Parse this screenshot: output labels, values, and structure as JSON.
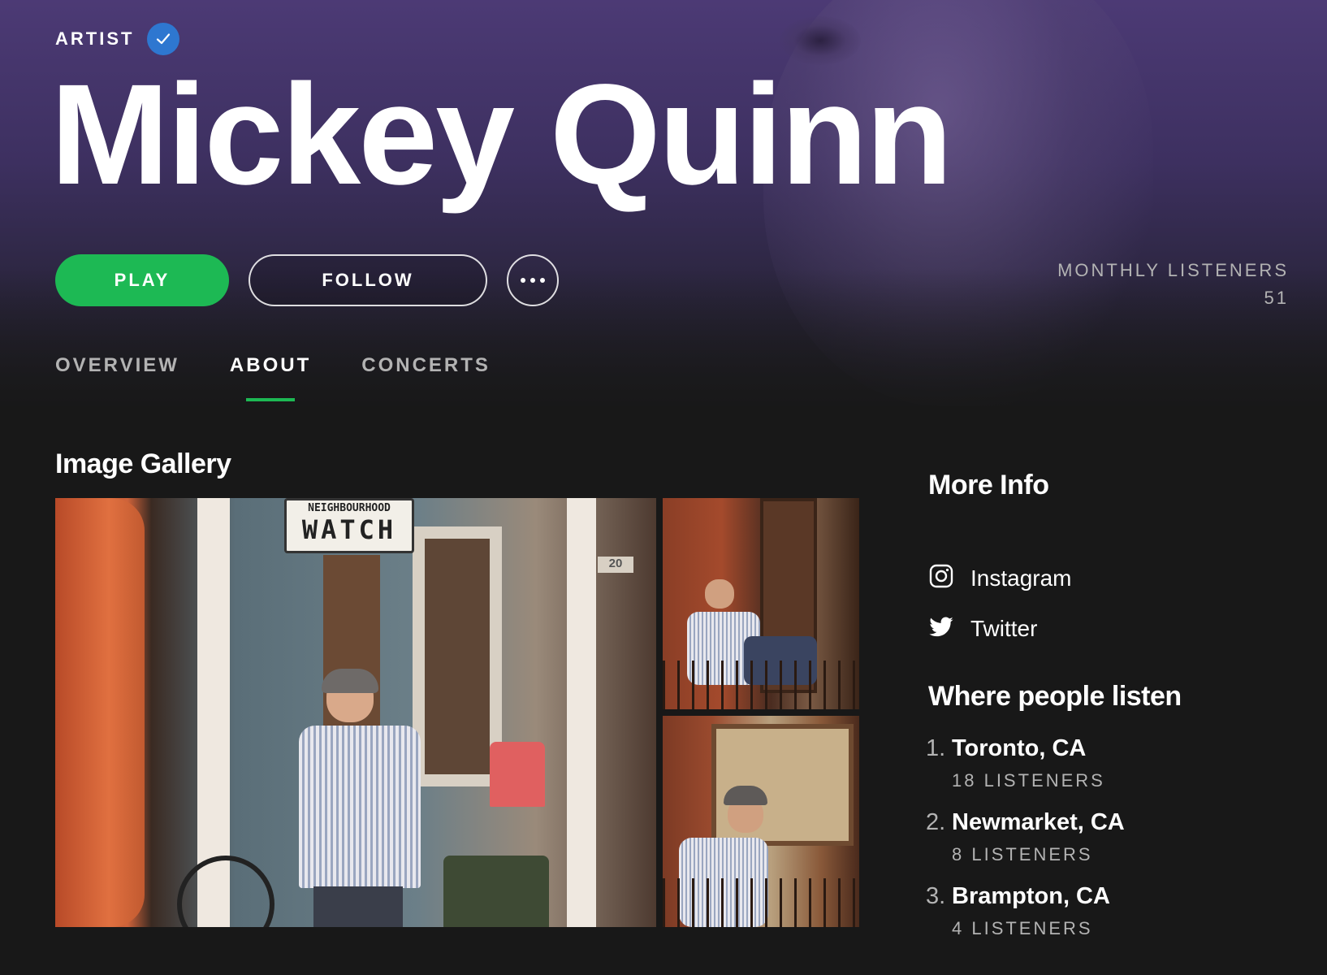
{
  "header": {
    "type_label": "ARTIST",
    "artist_name": "Mickey Quinn",
    "verified_icon": "verified-check-icon"
  },
  "actions": {
    "play_label": "PLAY",
    "follow_label": "FOLLOW",
    "more_icon": "more-horizontal-icon"
  },
  "stats": {
    "monthly_listeners_label": "MONTHLY LISTENERS",
    "monthly_listeners_value": "51"
  },
  "tabs": [
    {
      "label": "OVERVIEW",
      "active": false
    },
    {
      "label": "ABOUT",
      "active": true
    },
    {
      "label": "CONCERTS",
      "active": false
    }
  ],
  "gallery": {
    "title": "Image Gallery",
    "sign_text": "WATCH",
    "sign_subtext": "NEIGHBOURHOOD",
    "house_number": "20"
  },
  "more_info": {
    "title": "More Info",
    "links": [
      {
        "label": "Instagram",
        "icon": "instagram-icon"
      },
      {
        "label": "Twitter",
        "icon": "twitter-icon"
      }
    ]
  },
  "where": {
    "title": "Where people listen",
    "cities": [
      {
        "rank": "1.",
        "name": "Toronto, CA",
        "listeners": "18 LISTENERS"
      },
      {
        "rank": "2.",
        "name": "Newmarket, CA",
        "listeners": "8 LISTENERS"
      },
      {
        "rank": "3.",
        "name": "Brampton, CA",
        "listeners": "4 LISTENERS"
      }
    ]
  },
  "colors": {
    "accent": "#1db954",
    "verified": "#2e77d0",
    "background": "#181818"
  }
}
